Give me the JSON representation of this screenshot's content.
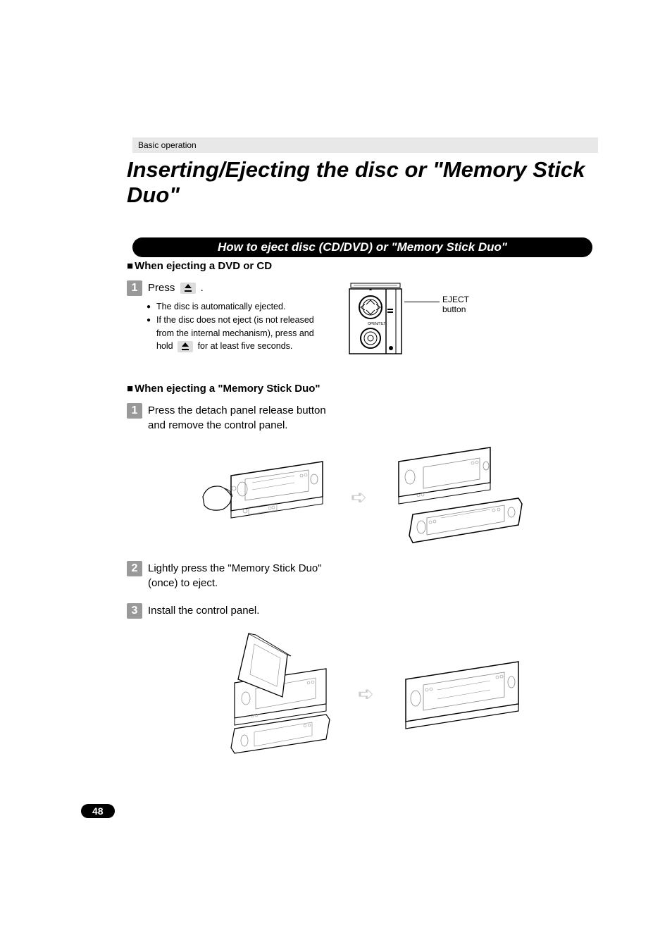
{
  "section_label": "Basic operation",
  "page_title": "Inserting/Ejecting the disc or \"Memory Stick Duo\"",
  "pill_header": "How to eject disc (CD/DVD) or \"Memory Stick Duo\"",
  "sub1": "When ejecting  a DVD or CD",
  "sub2": "When ejecting  a \"Memory Stick Duo\"",
  "step1a_prefix": "Press ",
  "step1a_suffix": " .",
  "bullet1": "The disc is automatically ejected.",
  "bullet2_prefix": "If the disc does not eject (is not released from the internal mechanism), press and hold ",
  "bullet2_suffix": " for at least five seconds.",
  "eject_label_line1": "EJECT",
  "eject_label_line2": "button",
  "step1b": "Press the detach panel release button and remove the control panel.",
  "step2": "Lightly press the \"Memory Stick Duo\" (once) to eject.",
  "step3": "Install the control panel.",
  "page_number": "48"
}
